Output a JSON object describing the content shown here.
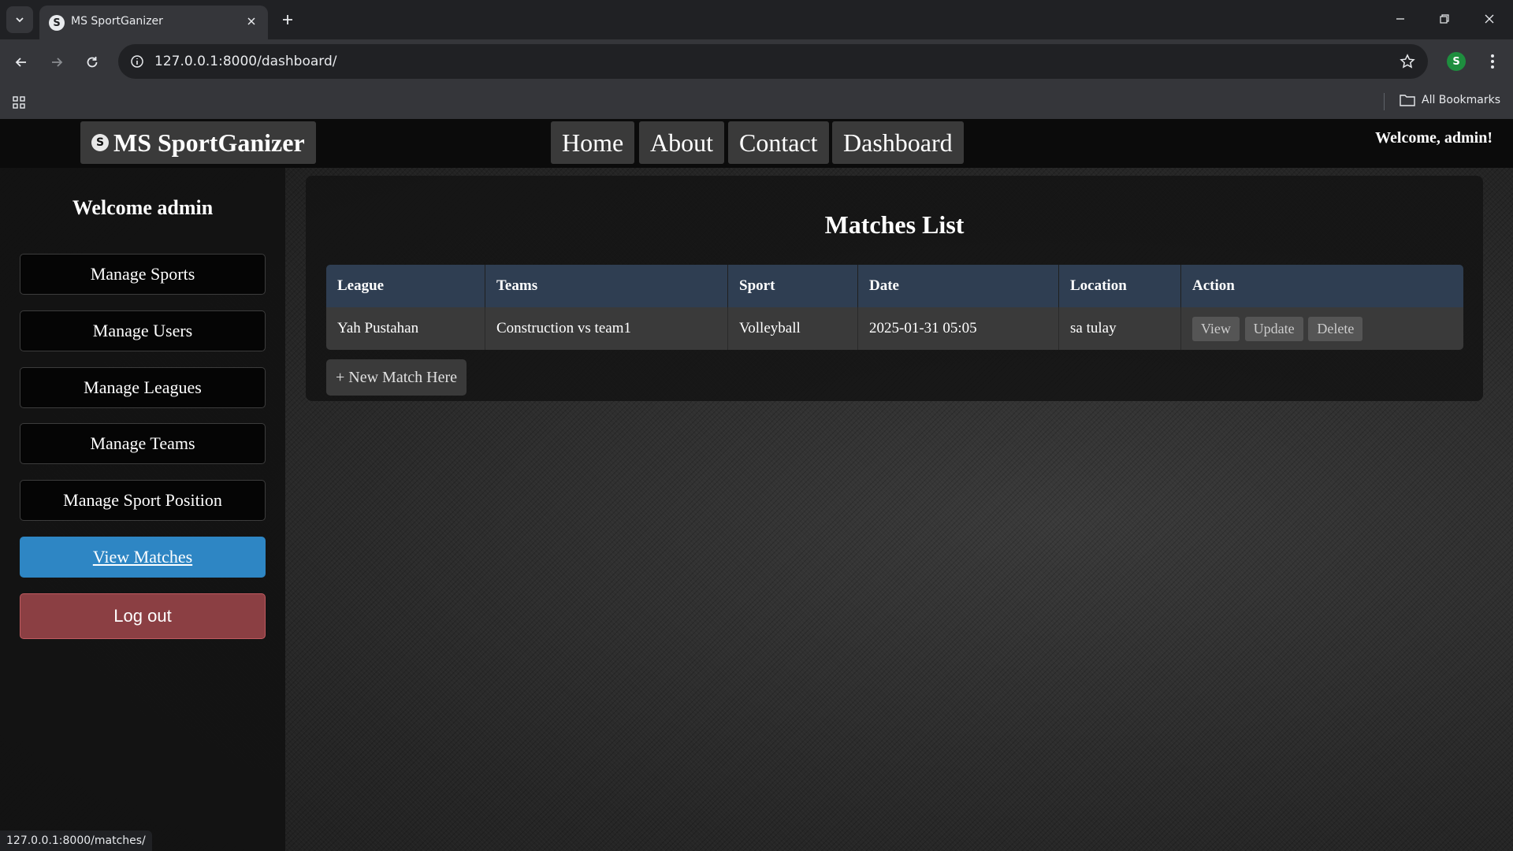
{
  "browser": {
    "tab_title": "MS SportGanizer",
    "url": "127.0.0.1:8000/dashboard/",
    "profile_initial": "S",
    "all_bookmarks": "All Bookmarks",
    "status_url": "127.0.0.1:8000/matches/"
  },
  "navbar": {
    "brand": "MS SportGanizer",
    "links": [
      "Home",
      "About",
      "Contact",
      "Dashboard"
    ],
    "welcome": "Welcome, admin!"
  },
  "sidebar": {
    "title": "Welcome admin",
    "items": [
      {
        "label": "Manage Sports"
      },
      {
        "label": "Manage Users"
      },
      {
        "label": "Manage Leagues"
      },
      {
        "label": "Manage Teams"
      },
      {
        "label": "Manage Sport Position"
      },
      {
        "label": "View Matches",
        "active": true
      }
    ],
    "logout": "Log out"
  },
  "main": {
    "title": "Matches List",
    "table": {
      "headers": [
        "League",
        "Teams",
        "Sport",
        "Date",
        "Location",
        "Action"
      ],
      "rows": [
        {
          "league": "Yah Pustahan",
          "teams": "Construction vs team1",
          "sport": "Volleyball",
          "date": "2025-01-31 05:05",
          "location": "sa tulay",
          "actions": [
            "View",
            "Update",
            "Delete"
          ]
        }
      ]
    },
    "new_match": "+ New Match Here"
  },
  "colors": {
    "active": "#2e86c4",
    "logout": "#8b3f43",
    "table_header": "#2f3e52"
  }
}
